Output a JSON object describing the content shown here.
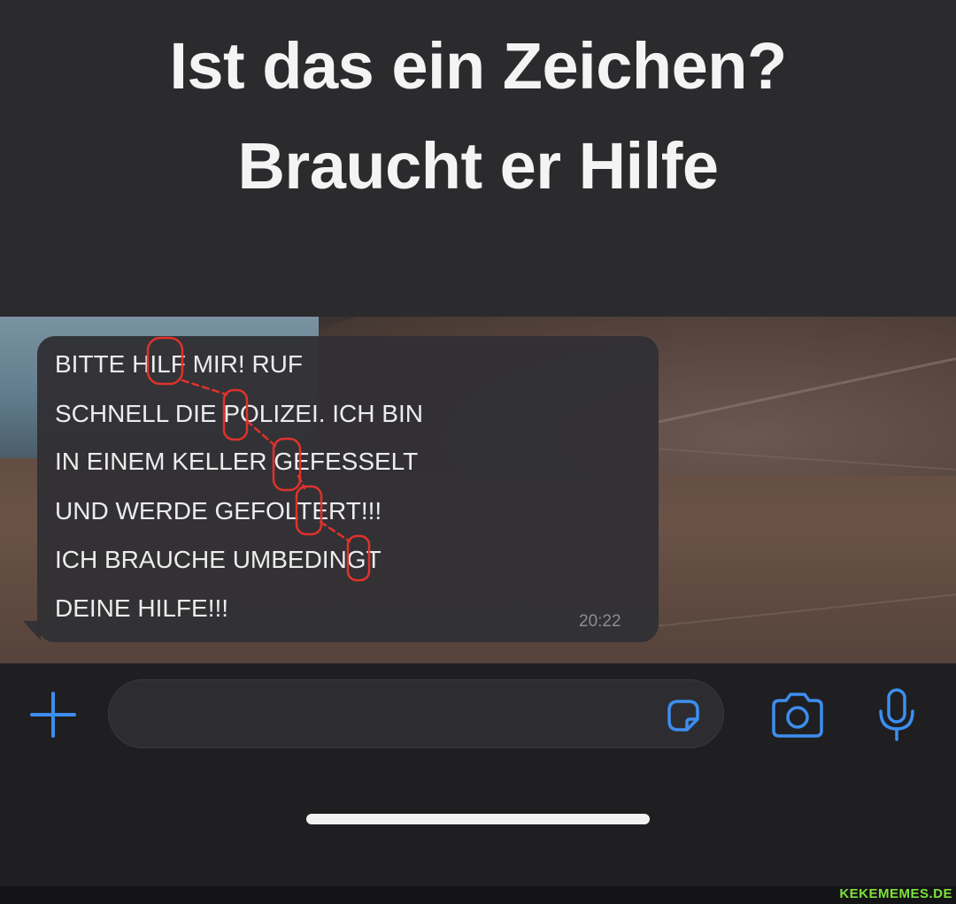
{
  "caption": {
    "line1": "Ist das ein Zeichen?",
    "line2": "Braucht er Hilfe"
  },
  "message": {
    "lines": [
      "BITTE HILF MIR! RUF",
      "SCHNELL DIE POLIZEI. ICH BIN",
      "IN EINEM KELLER GEFESSELT",
      "UND WERDE GEFOLTERT!!!",
      "ICH BRAUCHE UMBEDINGT",
      "DEINE HILFE!!!"
    ],
    "time": "20:22"
  },
  "toolbar": {
    "plus_icon": "plus-icon",
    "input_value": "",
    "sticker_icon": "sticker-icon",
    "camera_icon": "camera-icon",
    "mic_icon": "microphone-icon"
  },
  "colors": {
    "accent": "#3d8ef0",
    "annotation": "#e0322b",
    "bubble": "#313034",
    "watermark": "#7de23b"
  },
  "watermark": "KEKEMEMES.DE"
}
